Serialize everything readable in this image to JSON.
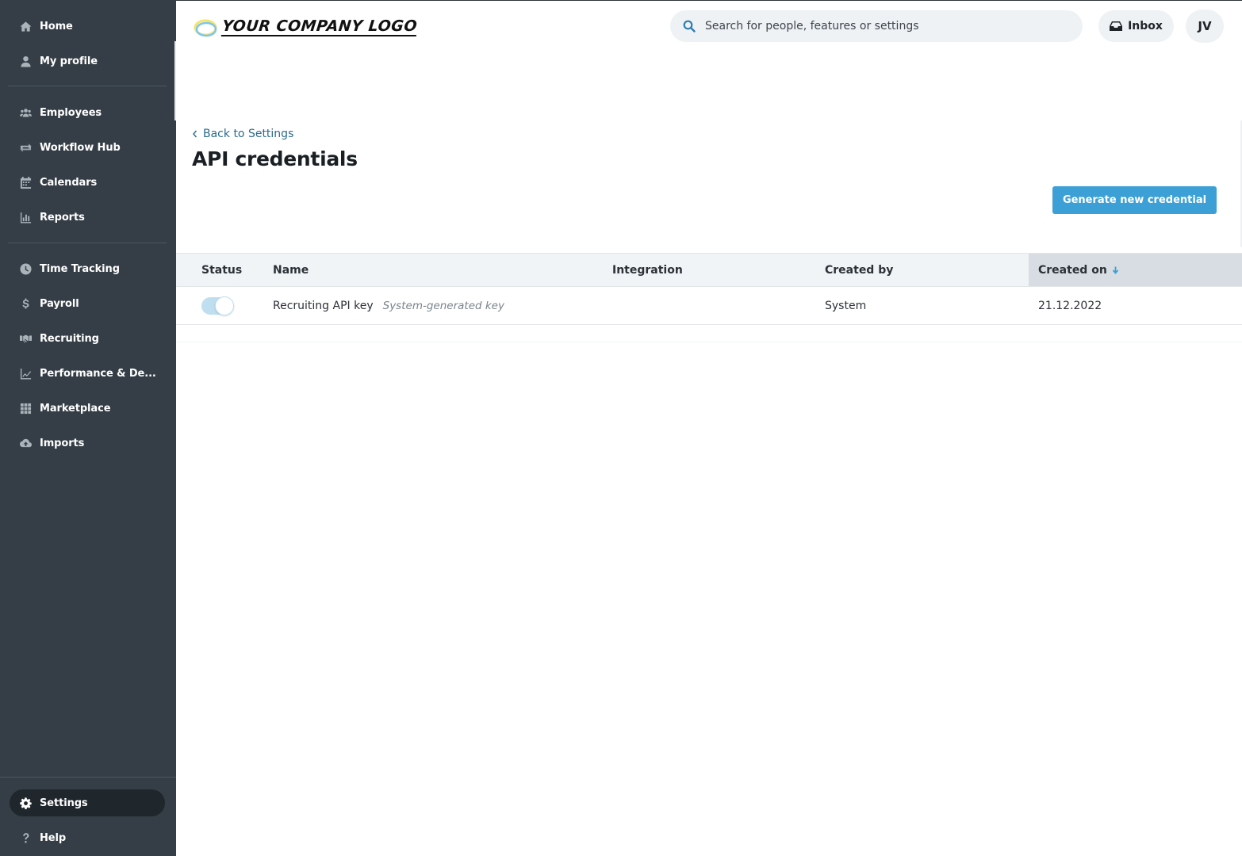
{
  "sidebar": {
    "items": [
      {
        "label": "Home",
        "icon": "home-icon"
      },
      {
        "label": "My profile",
        "icon": "user-icon"
      },
      {
        "label": "Employees",
        "icon": "users-icon"
      },
      {
        "label": "Workflow Hub",
        "icon": "workflow-icon"
      },
      {
        "label": "Calendars",
        "icon": "calendar-icon"
      },
      {
        "label": "Reports",
        "icon": "bar-chart-icon"
      },
      {
        "label": "Time Tracking",
        "icon": "clock-icon"
      },
      {
        "label": "Payroll",
        "icon": "dollar-icon"
      },
      {
        "label": "Recruiting",
        "icon": "handshake-icon"
      },
      {
        "label": "Performance & De...",
        "icon": "line-chart-icon"
      },
      {
        "label": "Marketplace",
        "icon": "grid-icon"
      },
      {
        "label": "Imports",
        "icon": "cloud-upload-icon"
      }
    ],
    "bottom": [
      {
        "label": "Settings",
        "icon": "gear-icon",
        "active": true
      },
      {
        "label": "Help",
        "icon": "question-icon"
      }
    ]
  },
  "header": {
    "logo_text": "YOUR COMPANY LOGO",
    "search_placeholder": "Search for people, features or settings",
    "inbox_label": "Inbox",
    "avatar_initials": "JV"
  },
  "page": {
    "back_link": "Back to Settings",
    "title": "API credentials",
    "primary_action": "Generate new credential"
  },
  "table": {
    "columns": [
      "Status",
      "Name",
      "Integration",
      "Created by",
      "Created on"
    ],
    "sorted_column": "Created on",
    "rows": [
      {
        "status_enabled": true,
        "name": "Recruiting API key",
        "name_note": "System-generated key",
        "integration": "",
        "created_by": "System",
        "created_on": "21.12.2022"
      }
    ]
  },
  "colors": {
    "sidebar_bg": "#353e46",
    "primary": "#3ca0d6",
    "link": "#2a6a8e"
  }
}
